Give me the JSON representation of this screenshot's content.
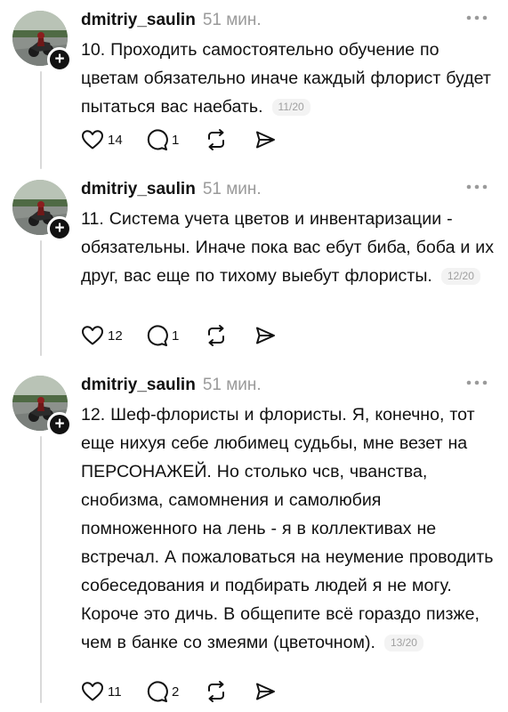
{
  "posts": [
    {
      "username": "dmitriy_saulin",
      "time": "51 мин.",
      "text": "10. Проходить самостоятельно обучение по цветам обязательно иначе каждый флорист будет пытаться вас наебать.",
      "counter": "11/20",
      "likes": "14",
      "replies": "1"
    },
    {
      "username": "dmitriy_saulin",
      "time": "51 мин.",
      "text": "11. Система учета цветов и инвентаризации - обязательны. Иначе пока вас ебут биба, боба и их друг, вас еще по тихому выебут флористы.",
      "counter": "12/20",
      "likes": "12",
      "replies": "1"
    },
    {
      "username": "dmitriy_saulin",
      "time": "51 мин.",
      "text": "12. Шеф-флористы и флористы. Я, конечно, тот еще нихуя себе любимец судьбы, мне везет на ПЕРСОНАЖЕЙ. Но столько чсв, чванства, снобизма, самомнения и самолюбия помноженного на лень - я в коллективах не встречал. А пожаловаться на неумение проводить собеседования и подбирать людей я не могу. Короче это дичь. В общепите всё гораздо пизже, чем в банке со змеями (цветочном).",
      "counter": "13/20",
      "likes": "11",
      "replies": "2"
    }
  ],
  "icons": {
    "avatar": "avatar-photo-motorcycle",
    "follow": "plus-icon",
    "more": "more-dots-icon",
    "like": "heart-icon",
    "reply": "comment-bubble-icon",
    "repost": "repost-arrows-icon",
    "share": "share-send-icon"
  },
  "colors": {
    "text": "#111111",
    "muted": "#9a9a9a",
    "thread_line": "#d9d9d9",
    "counter_bg": "#f3f3f3"
  }
}
